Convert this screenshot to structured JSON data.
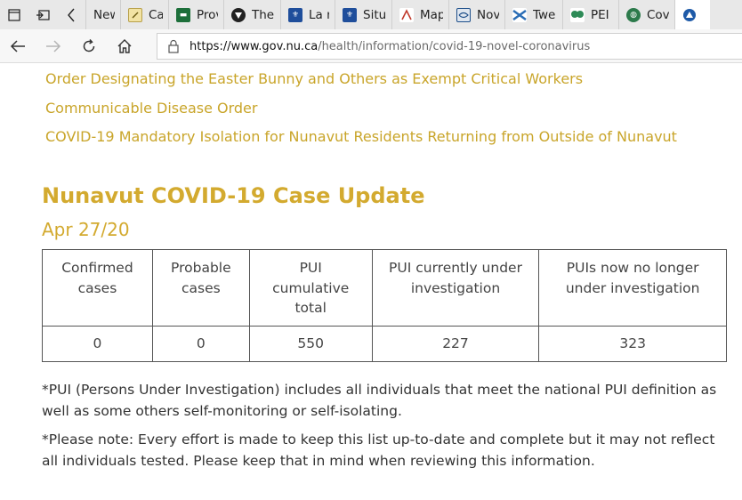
{
  "tabs": [
    {
      "label": "New",
      "icon": "new-tab-icon",
      "color": "#ffffff"
    },
    {
      "label": "Case",
      "icon": "document-icon",
      "color": "#f2e3a4"
    },
    {
      "label": "Prov",
      "icon": "provincial-logo-icon",
      "color": "#1d6f3a"
    },
    {
      "label": "The",
      "icon": "triangle-logo-icon",
      "color": "#222222"
    },
    {
      "label": "La n",
      "icon": "fleur-de-lis-icon",
      "color": "#1f4e9b"
    },
    {
      "label": "Situ",
      "icon": "fleur-de-lis-icon",
      "color": "#1f4e9b"
    },
    {
      "label": "Map",
      "icon": "map-icon",
      "color": "#c0392b"
    },
    {
      "label": "Nov",
      "icon": "crest-icon",
      "color": "#1e4f8a"
    },
    {
      "label": "Twe",
      "icon": "flag-icon",
      "color": "#2a6db5"
    },
    {
      "label": "PEI (",
      "icon": "tree-icon",
      "color": "#2e8b57"
    },
    {
      "label": "Cov",
      "icon": "globe-icon",
      "color": "#2c7a4b"
    }
  ],
  "browser": {
    "url_domain": "https://www.gov.nu.ca",
    "url_path": "/health/information/covid-19-novel-coronavirus"
  },
  "page": {
    "links": [
      "Order Designating the Easter Bunny and Others as Exempt Critical Workers",
      "Communicable Disease Order",
      "COVID-19 Mandatory Isolation for Nunavut Residents Returning from Outside of Nunavut"
    ],
    "title": "Nunavut COVID-19 Case Update",
    "date": "Apr 27/20",
    "table": {
      "headers": [
        [
          "Confirmed",
          "cases"
        ],
        [
          "Probable",
          "cases"
        ],
        [
          "PUI",
          "cumulative",
          "total"
        ],
        [
          "PUI currently under",
          "investigation"
        ],
        [
          "PUIs now no longer",
          "under investigation"
        ]
      ],
      "values": [
        "0",
        "0",
        "550",
        "227",
        "323"
      ]
    },
    "notes": [
      "*PUI (Persons Under Investigation) includes all individuals that meet the national PUI definition as well as some others self-monitoring or self-isolating.",
      "*Please note: Every effort is made to keep this list up-to-date and complete but it may not reflect all individuals tested. Please keep that in mind when reviewing this information."
    ]
  },
  "colors": {
    "accent": "#d3aa2f",
    "link": "#c9a52a",
    "text": "#333333",
    "tabstrip": "#e8e8e8"
  }
}
